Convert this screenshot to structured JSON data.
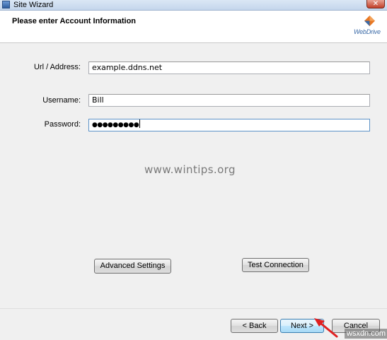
{
  "window": {
    "title": "Site Wizard",
    "close_glyph": "✕"
  },
  "header": {
    "title": "Please enter Account Information",
    "logo_text": "WebDrive",
    "logo_icon": "webdrive-logo-icon"
  },
  "form": {
    "url": {
      "label": "Url / Address:",
      "value": "example.ddns.net"
    },
    "username": {
      "label": "Username:",
      "value": "Bill"
    },
    "password": {
      "label": "Password:",
      "value": "●●●●●●●●●"
    }
  },
  "watermark": "www.wintips.org",
  "buttons": {
    "advanced_settings": "Advanced Settings",
    "test_connection": "Test Connection",
    "back": "< Back",
    "next": "Next >",
    "cancel": "Cancel"
  },
  "corner_watermark": "wsxdn.com",
  "colors": {
    "arrow": "#e02020",
    "primary_border": "#3c7fb1"
  }
}
